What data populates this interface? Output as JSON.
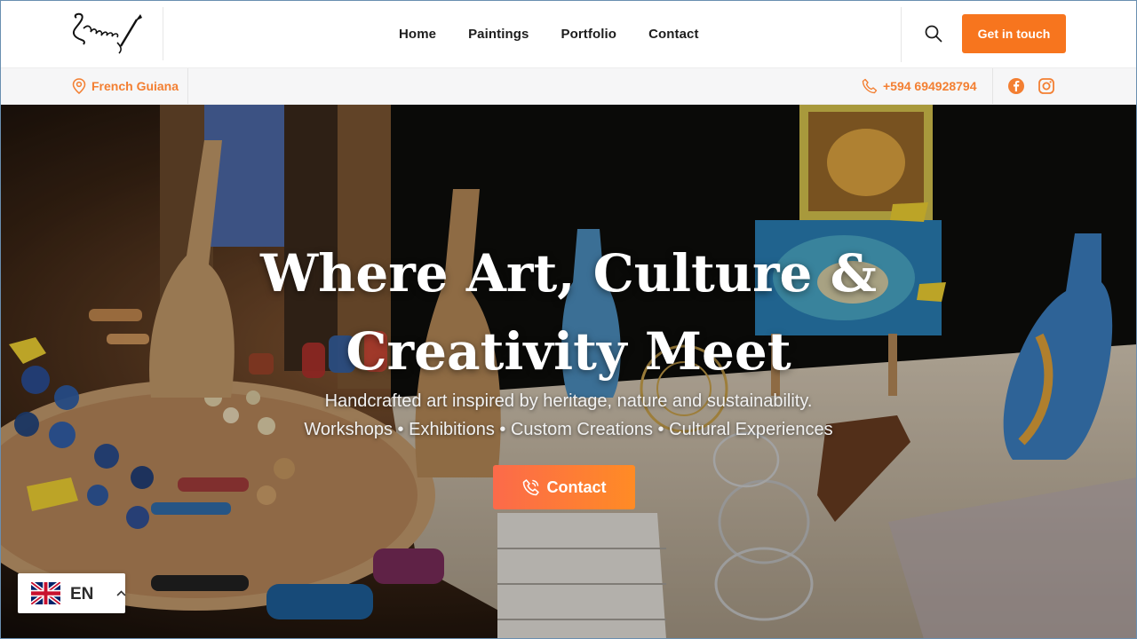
{
  "header": {
    "logo_alt": "artist signature logo",
    "nav": [
      "Home",
      "Paintings",
      "Portfolio",
      "Contact"
    ],
    "cta_label": "Get in touch",
    "search_icon": "search-icon"
  },
  "infobar": {
    "location": "French Guiana",
    "location_icon": "map-pin-icon",
    "phone": "+594 694928794",
    "phone_icon": "phone-icon",
    "social": [
      "facebook-icon",
      "instagram-icon"
    ]
  },
  "hero": {
    "title_line1": "Where Art, Culture &",
    "title_line2": "Creativity Meet",
    "subtitle_line1": "Handcrafted art inspired by heritage, nature and sustainability.",
    "subtitle_line2": "Workshops • Exhibitions • Custom Creations • Cultural Experiences",
    "button_label": "Contact",
    "button_icon": "phone-call-icon"
  },
  "language": {
    "code": "EN",
    "flag": "uk-flag-icon",
    "chevron": "chevron-up-icon"
  },
  "colors": {
    "accent": "#f7751e",
    "accent_text": "#f37f32",
    "hero_btn_start": "#fc6a4a",
    "hero_btn_end": "#ff8b25"
  }
}
